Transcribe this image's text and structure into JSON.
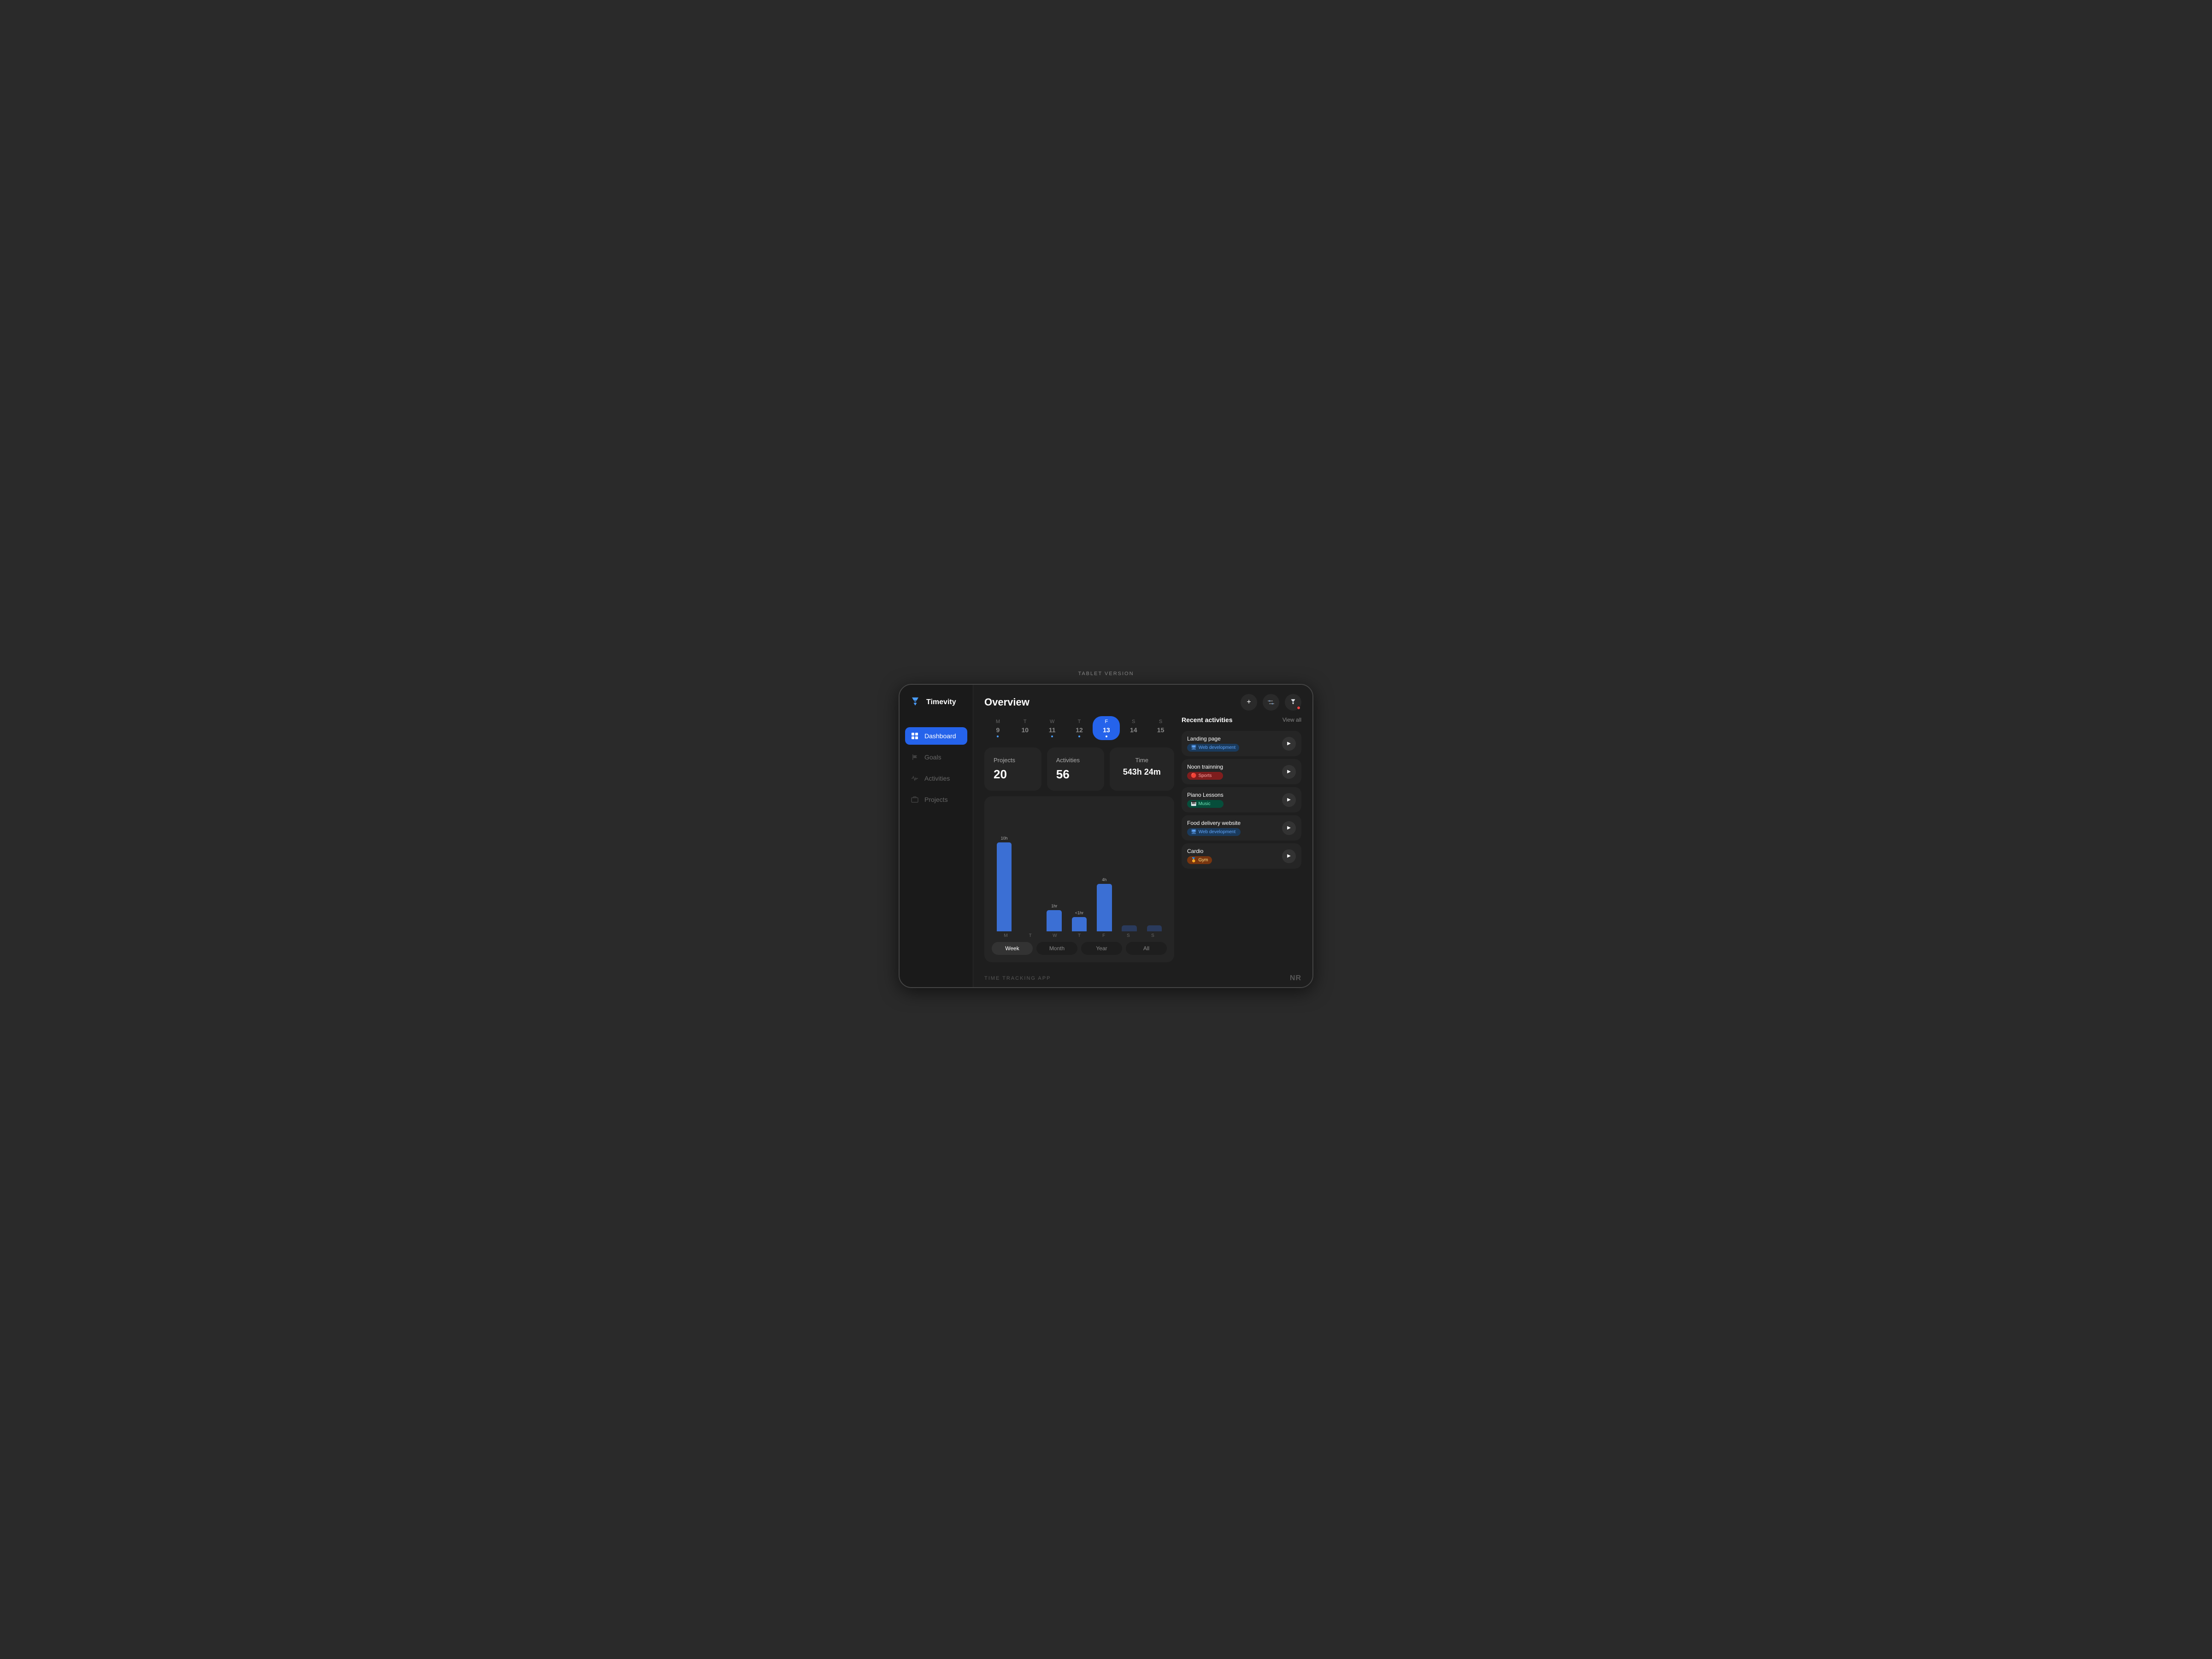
{
  "page": {
    "version_label": "TABLET VERSION",
    "footer_left": "TIME TRACKING APP",
    "footer_right": "NR"
  },
  "sidebar": {
    "logo_text": "Timevity",
    "nav_items": [
      {
        "id": "dashboard",
        "label": "Dashboard",
        "active": true
      },
      {
        "id": "goals",
        "label": "Goals",
        "active": false
      },
      {
        "id": "activities",
        "label": "Activities",
        "active": false
      },
      {
        "id": "projects",
        "label": "Projects",
        "active": false
      }
    ]
  },
  "header": {
    "title": "Overview",
    "add_label": "+",
    "filter_label": "⊟",
    "avatar_label": "⏳"
  },
  "calendar": {
    "days": [
      {
        "letter": "M",
        "num": "9",
        "has_dot": true,
        "today": false
      },
      {
        "letter": "T",
        "num": "10",
        "has_dot": false,
        "today": false
      },
      {
        "letter": "W",
        "num": "11",
        "has_dot": true,
        "today": false
      },
      {
        "letter": "T",
        "num": "12",
        "has_dot": true,
        "today": false
      },
      {
        "letter": "F",
        "num": "13",
        "has_dot": true,
        "today": true
      },
      {
        "letter": "S",
        "num": "14",
        "has_dot": false,
        "today": false
      },
      {
        "letter": "S",
        "num": "15",
        "has_dot": false,
        "today": false
      }
    ]
  },
  "stats": {
    "projects_label": "Projects",
    "projects_value": "20",
    "activities_label": "Activities",
    "activities_value": "56",
    "time_label": "Time",
    "time_value": "543h 24m"
  },
  "chart": {
    "bars": [
      {
        "day": "M",
        "height": 75,
        "label": "10h",
        "show_label": true,
        "dark": false
      },
      {
        "day": "T",
        "height": 0,
        "label": "",
        "show_label": false,
        "dark": true
      },
      {
        "day": "W",
        "height": 18,
        "label": "1hr",
        "show_label": true,
        "dark": false
      },
      {
        "day": "T",
        "height": 12,
        "label": "<1hr",
        "show_label": true,
        "dark": false
      },
      {
        "day": "F",
        "height": 40,
        "label": "4h",
        "show_label": true,
        "dark": false
      },
      {
        "day": "S",
        "height": 5,
        "label": "",
        "show_label": false,
        "dark": true
      },
      {
        "day": "S",
        "height": 5,
        "label": "",
        "show_label": false,
        "dark": true
      }
    ]
  },
  "period_buttons": [
    {
      "label": "Week",
      "active": true
    },
    {
      "label": "Month",
      "active": false
    },
    {
      "label": "Year",
      "active": false
    },
    {
      "label": "All",
      "active": false
    }
  ],
  "recent_activities": {
    "title": "Recent activities",
    "view_all": "View all",
    "items": [
      {
        "name": "Landing page",
        "tag_label": "Web development",
        "tag_icon": "🖥",
        "tag_class": "tag-web"
      },
      {
        "name": "Noon trainning",
        "tag_label": "Sports",
        "tag_icon": "🔴",
        "tag_class": "tag-sports"
      },
      {
        "name": "Piano Lessons",
        "tag_label": "Music",
        "tag_icon": "🎹",
        "tag_class": "tag-music"
      },
      {
        "name": "Food delivery website",
        "tag_label": "Web development",
        "tag_icon": "🖥",
        "tag_class": "tag-web"
      },
      {
        "name": "Cardio",
        "tag_label": "Gym",
        "tag_icon": "🏅",
        "tag_class": "tag-gym"
      }
    ]
  }
}
